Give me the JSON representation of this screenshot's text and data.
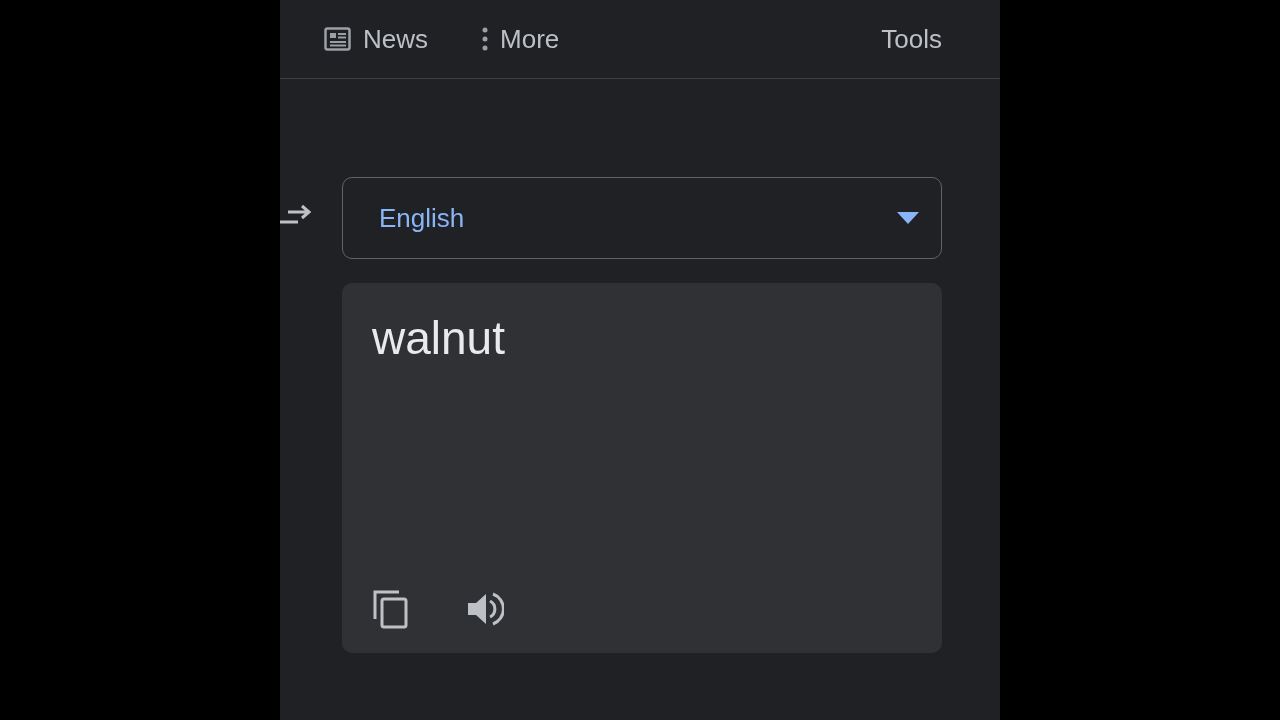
{
  "nav": {
    "tabs": [
      {
        "kind": "news",
        "label": "News"
      },
      {
        "kind": "more",
        "label": "More"
      }
    ],
    "tools": "Tools"
  },
  "translator": {
    "language": "English",
    "result": "walnut"
  }
}
